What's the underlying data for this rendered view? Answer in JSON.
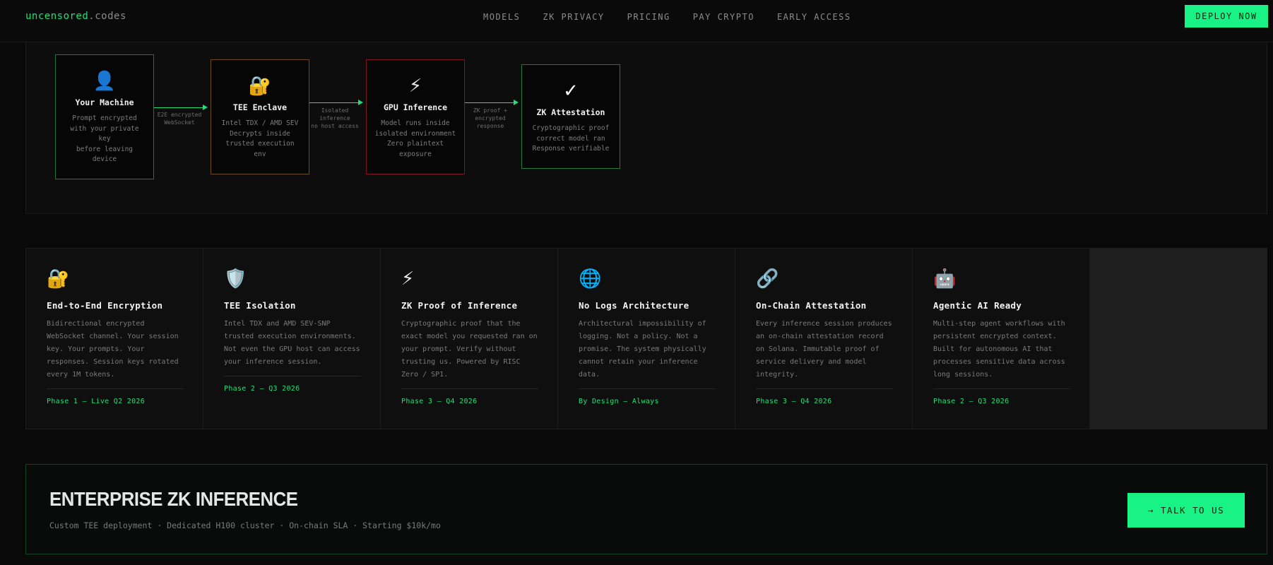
{
  "nav": {
    "logo_primary": "uncensored",
    "logo_secondary": ".codes",
    "links": [
      "MODELS",
      "ZK PRIVACY",
      "PRICING",
      "PAY CRYPTO",
      "EARLY ACCESS"
    ],
    "cta": "DEPLOY NOW"
  },
  "architecture": {
    "nodes": [
      {
        "icon": "👤",
        "title": "Your Machine",
        "desc": [
          "Prompt encrypted",
          "with your private",
          "key",
          "before leaving",
          "device"
        ]
      },
      {
        "icon": "🔐",
        "title": "TEE Enclave",
        "desc": [
          "Intel TDX / AMD SEV",
          "Decrypts inside",
          "trusted execution",
          "env"
        ]
      },
      {
        "icon": "⚡",
        "title": "GPU Inference",
        "desc": [
          "Model runs inside",
          "isolated environment",
          "Zero plaintext",
          "exposure"
        ]
      },
      {
        "icon": "✓",
        "title": "ZK Attestation",
        "desc": [
          "Cryptographic proof",
          "correct model ran",
          "Response verifiable"
        ]
      }
    ],
    "arrows": [
      {
        "label": [
          "E2E encrypted",
          "WebSocket"
        ]
      },
      {
        "label": [
          "Isolated",
          "inference",
          "no host access"
        ]
      },
      {
        "label": [
          "ZK proof +",
          "encrypted",
          "response"
        ]
      }
    ],
    "colors": {
      "node1": "#1f7a3f",
      "node2": "#6b4a14",
      "node3": "#7a1426",
      "node4": "#1f7a3f",
      "arrow": "#1fe07a"
    }
  },
  "features": [
    {
      "icon": "🔐",
      "title": "End-to-End Encryption",
      "desc": "Bidirectional encrypted WebSocket channel. Your session key. Your prompts. Your responses. Session keys rotated every 1M tokens.",
      "phase": "Phase 1 — Live Q2 2026"
    },
    {
      "icon": "🛡️",
      "title": "TEE Isolation",
      "desc": "Intel TDX and AMD SEV-SNP trusted execution environments. Not even the GPU host can access your inference session.",
      "phase": "Phase 2 — Q3 2026"
    },
    {
      "icon": "⚡",
      "title": "ZK Proof of Inference",
      "desc": "Cryptographic proof that the exact model you requested ran on your prompt. Verify without trusting us. Powered by RISC Zero / SP1.",
      "phase": "Phase 3 — Q4 2026"
    },
    {
      "icon": "🌐",
      "title": "No Logs Architecture",
      "desc": "Architectural impossibility of logging. Not a policy. Not a promise. The system physically cannot retain your inference data.",
      "phase": "By Design — Always"
    },
    {
      "icon": "🔗",
      "title": "On-Chain Attestation",
      "desc": "Every inference session produces an on-chain attestation record on Solana. Immutable proof of service delivery and model integrity.",
      "phase": "Phase 3 — Q4 2026"
    },
    {
      "icon": "🤖",
      "title": "Agentic AI Ready",
      "desc": "Multi-step agent workflows with persistent encrypted context. Built for autonomous AI that processes sensitive data across long sessions.",
      "phase": "Phase 2 — Q3 2026"
    }
  ],
  "enterprise": {
    "title": "ENTERPRISE ZK INFERENCE",
    "subtitle": "Custom TEE deployment · Dedicated H100 cluster · On-chain SLA · Starting $10k/mo",
    "cta": "→ TALK TO US"
  }
}
